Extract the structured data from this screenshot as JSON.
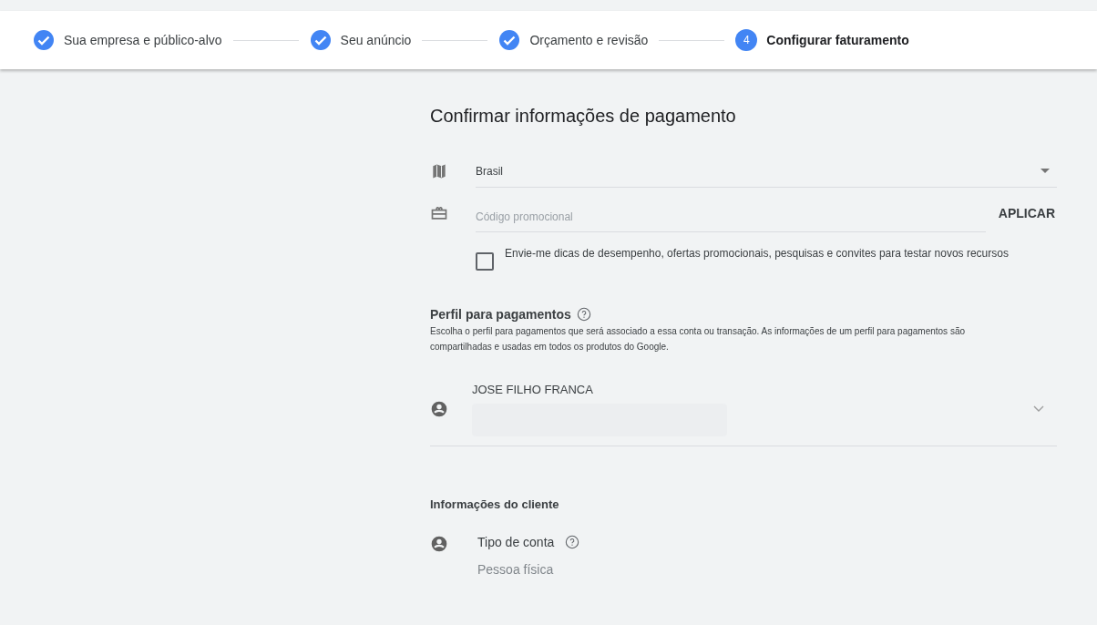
{
  "steps": [
    {
      "label": "Sua empresa e público-alvo",
      "completed": true,
      "selected": false
    },
    {
      "label": "Seu anúncio",
      "completed": true,
      "selected": false
    },
    {
      "label": "Orçamento e revisão",
      "completed": true,
      "selected": false
    },
    {
      "label": "Configurar faturamento",
      "completed": false,
      "selected": true,
      "number": "4"
    }
  ],
  "title": "Confirmar informações de pagamento",
  "country": {
    "value": "Brasil"
  },
  "promo": {
    "placeholder": "Código promocional",
    "button": "APLICAR"
  },
  "newsletter": {
    "label": "Envie-me dicas de desempenho, ofertas promocionais, pesquisas e convites para testar novos recursos",
    "checked": false
  },
  "payments_profile": {
    "heading": "Perfil para pagamentos",
    "description": "Escolha o perfil para pagamentos que será associado a essa conta ou transação. As informações de um perfil para pagamentos são compartilhadas e usadas em todos os produtos do Google.",
    "name": "JOSE FILHO FRANCA"
  },
  "client_info": {
    "heading": "Informações do cliente",
    "account_type_label": "Tipo de conta",
    "account_type_value": "Pessoa física"
  }
}
